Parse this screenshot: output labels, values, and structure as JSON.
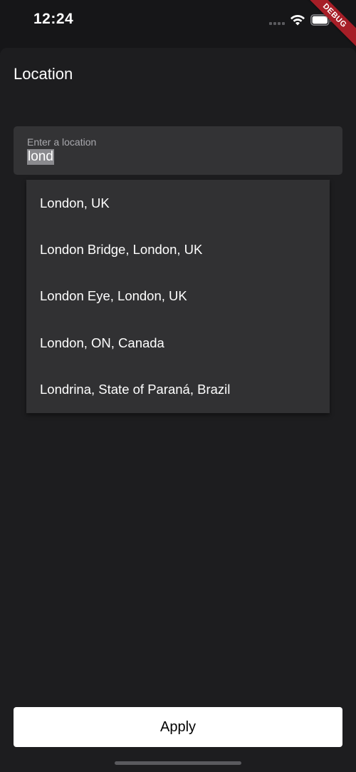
{
  "status_bar": {
    "time": "12:24",
    "debug_label": "DEBUG",
    "icons": [
      "signal-dots-icon",
      "wifi-icon",
      "battery-icon"
    ]
  },
  "header": {
    "title": "Location"
  },
  "location_input": {
    "label": "Enter a location",
    "value": "lond"
  },
  "suggestions": [
    {
      "label": "London, UK"
    },
    {
      "label": "London Bridge, London, UK"
    },
    {
      "label": "London Eye, London, UK"
    },
    {
      "label": "London, ON, Canada"
    },
    {
      "label": "Londrina, State of Paraná, Brazil"
    }
  ],
  "actions": {
    "apply_label": "Apply"
  },
  "colors": {
    "background": "#1d1d1f",
    "field_background": "#333335",
    "dropdown_background": "#313133",
    "debug_banner": "#a61e27",
    "button_background": "#ffffff"
  }
}
